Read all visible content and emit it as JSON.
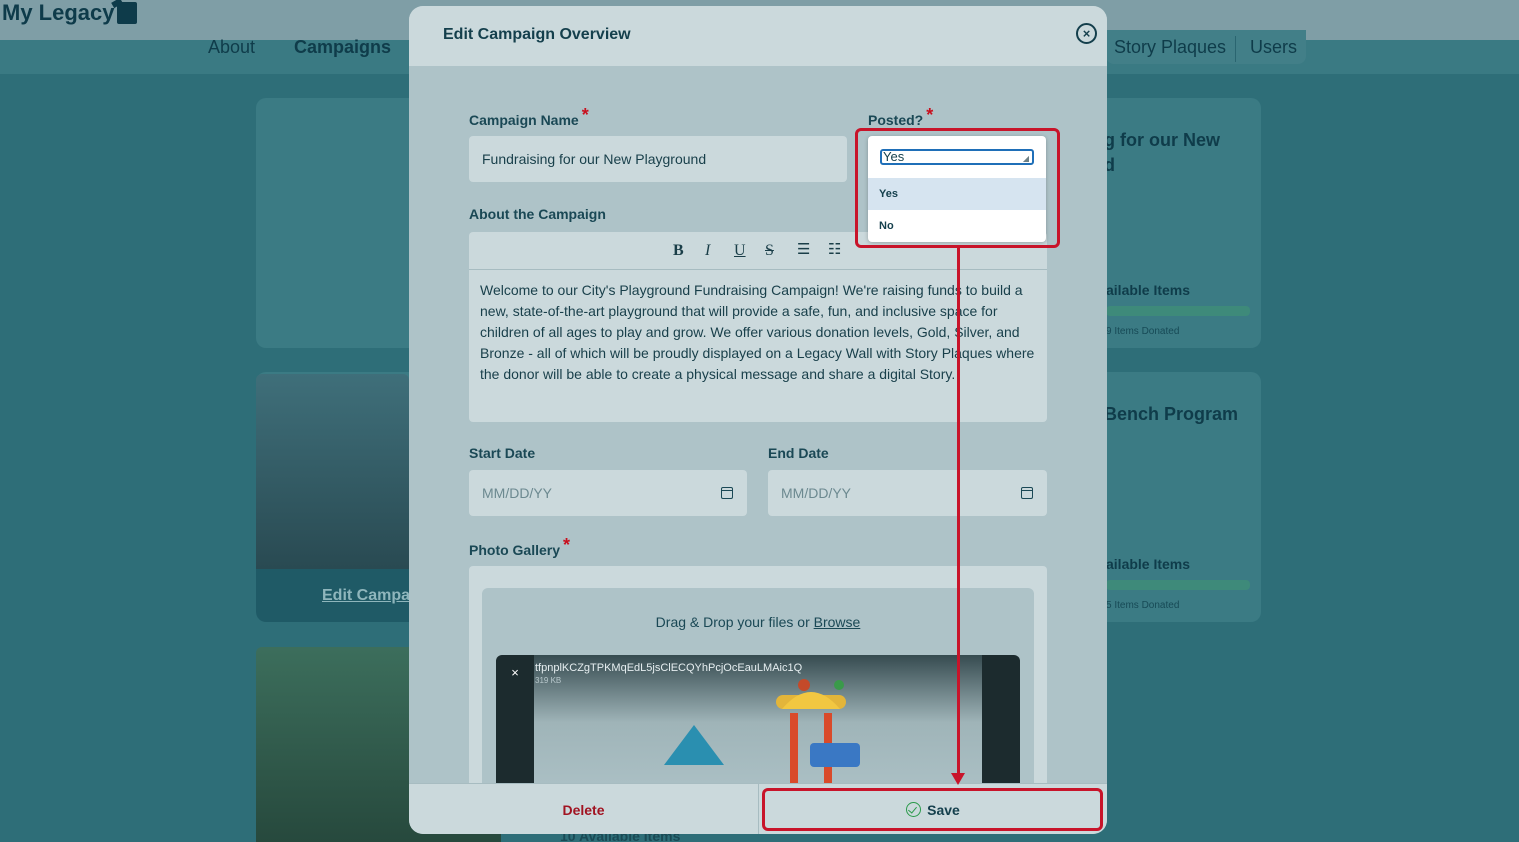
{
  "app": {
    "logo_text": "My Legacy",
    "nav": {
      "about": "About",
      "campaigns": "Campaigns",
      "story_plaques": "Story Plaques",
      "users": "Users"
    }
  },
  "background_cards": {
    "card1_title": "g for our New",
    "card1_title2": "d",
    "card1_available": "ailable Items",
    "card1_donated": "9 Items Donated",
    "card2_title": "Bench Program",
    "card2_available": "ailable Items",
    "card2_donated": "5 Items Donated",
    "card3_available": "10 Available Items",
    "edit_link": "Edit Campa"
  },
  "modal": {
    "title": "Edit Campaign Overview",
    "campaign_name_label": "Campaign Name",
    "campaign_name_value": "Fundraising for our New Playground",
    "posted_label": "Posted?",
    "about_label": "About the Campaign",
    "about_text": "Welcome to our City's Playground Fundraising Campaign! We're raising funds to build a new, state-of-the-art playground that will provide a safe, fun, and inclusive space for children of all ages to play and grow. We offer various donation levels, Gold, Silver, and Bronze - all of which will be proudly displayed on a Legacy Wall with Story Plaques where the donor will be able to create a physical message and share a digital Story.",
    "toolbar": {
      "bold": "B",
      "italic": "I",
      "underline": "U",
      "strike": "S"
    },
    "start_date_label": "Start Date",
    "start_date_placeholder": "MM/DD/YY",
    "end_date_label": "End Date",
    "end_date_placeholder": "MM/DD/YY",
    "photo_gallery_label": "Photo Gallery",
    "drop_text": "Drag & Drop your files or",
    "browse_label": "Browse",
    "file": {
      "name": "tfpnplKCZgTPKMqEdL5jsClECQYhPcjOcEauLMAic1Q",
      "size": "319 KB",
      "remove": "×"
    },
    "delete_label": "Delete",
    "save_label": "Save",
    "required_mark": "*",
    "close_symbol": "×"
  },
  "dropdown": {
    "selected": "Yes",
    "options": [
      "Yes",
      "No"
    ]
  },
  "colors": {
    "accent_red": "#c8142a",
    "brand_dark": "#143f4c",
    "save_check": "#2a9a4a"
  }
}
